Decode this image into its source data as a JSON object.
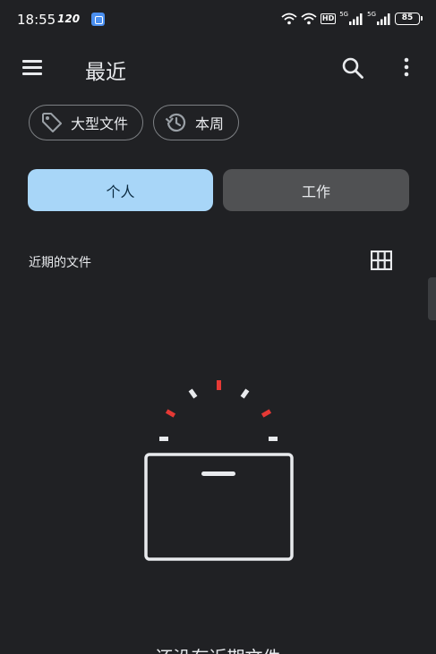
{
  "status_bar": {
    "time": "18:55",
    "refresh_rate": "120",
    "hd_label": "HD",
    "signal_1_label": "5G",
    "signal_2_label": "5G",
    "battery": "85"
  },
  "app_bar": {
    "title": "最近"
  },
  "filters": [
    {
      "label": "大型文件",
      "icon": "label-tag-icon"
    },
    {
      "label": "本周",
      "icon": "history-icon"
    }
  ],
  "account_toggle": {
    "personal_label": "个人",
    "work_label": "工作",
    "selected": "personal"
  },
  "section": {
    "title": "近期的文件",
    "view_mode": "grid-view-icon"
  },
  "empty_state": {
    "text": "还没有近期文件"
  },
  "colors": {
    "background": "#202124",
    "selected_segment": "#a8d6f8",
    "unselected_segment": "#505153",
    "illustration_accent": "#e53935"
  }
}
